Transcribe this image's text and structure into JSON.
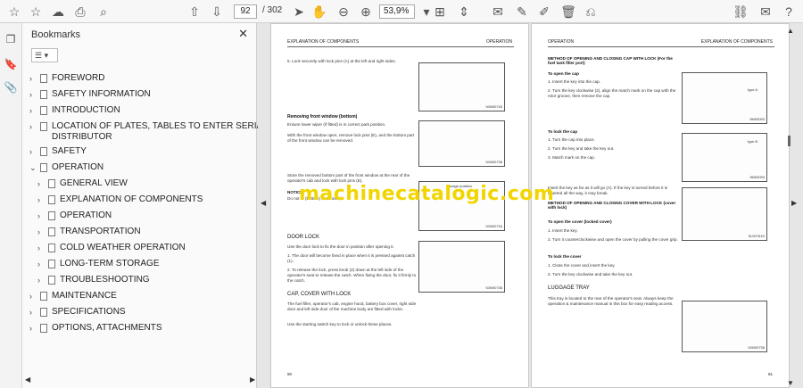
{
  "toolbar": {
    "page_current": "92",
    "page_total": "/ 302",
    "zoom": "53,9%"
  },
  "panel": {
    "title": "Bookmarks",
    "items": [
      {
        "label": "FOREWORD",
        "expanded": false
      },
      {
        "label": "SAFETY INFORMATION",
        "expanded": false
      },
      {
        "label": "INTRODUCTION",
        "expanded": false
      },
      {
        "label": "LOCATION OF PLATES, TABLES TO ENTER SERIAL NO. AND",
        "expanded": false
      },
      {
        "label": "DISTRIBUTOR"
      },
      {
        "label": "SAFETY",
        "expanded": false
      },
      {
        "label": "OPERATION",
        "expanded": true
      },
      {
        "label": "GENERAL VIEW",
        "expanded": false
      },
      {
        "label": "EXPLANATION OF COMPONENTS",
        "expanded": false
      },
      {
        "label": "OPERATION",
        "expanded": false
      },
      {
        "label": "TRANSPORTATION",
        "expanded": false
      },
      {
        "label": "COLD WEATHER OPERATION",
        "expanded": false
      },
      {
        "label": "LONG-TERM STORAGE",
        "expanded": false
      },
      {
        "label": "TROUBLESHOOTING",
        "expanded": false
      },
      {
        "label": "MAINTENANCE",
        "expanded": false
      },
      {
        "label": "SPECIFICATIONS",
        "expanded": false
      },
      {
        "label": "OPTIONS, ATTACHMENTS",
        "expanded": false
      }
    ]
  },
  "left_page": {
    "header_left": "EXPLANATION OF COMPONENTS",
    "header_right": "OPERATION",
    "step5": "5.   Lock securely with lock pins (A) at the left and right sides.",
    "fig1_id": "9JM00745",
    "removing_title": "Removing front window (bottom)",
    "removing_p1": "Ensure lower wiper (if fitted) is in correct park position.",
    "removing_p2": "With the front window open, remove lock pins (E), and the bottom part of the front window can be removed.",
    "fig2_id": "9JM00736",
    "store_p": "Store the removed bottom part of the front window at the rear of the operator's cab and lock with lock pins (E).",
    "notice_label": "NOTICE",
    "notice_text": "Do not ... (bottom) is removed.",
    "fig3_label": "Storage position",
    "fig3_id": "9JM00734",
    "door_title": "DOOR LOCK",
    "door_p1": "Use the door lock to fix the door in position after opening it.",
    "door_s1": "1.   The door will become fixed in place when it is pressed against catch (1).",
    "door_s2": "2.   To release the lock, press knob (2) down at the left side of the operator's seat to release the catch. When fixing the door, fix it firmly to the catch.",
    "fig4_id": "9JM00736",
    "cap_title": "CAP, COVER WITH LOCK",
    "cap_p1": "The fuel filler, operator's cab, engine hood, battery box cover, right side door and left side door of the machine body are fitted with locks.",
    "cap_p2": "Use the starting switch key to lock or unlock these places.",
    "page_no": "90"
  },
  "right_page": {
    "header_left": "OPERATION",
    "header_right": "EXPLANATION OF COMPONENTS",
    "method1_title": "METHOD OF OPENING AND CLOSING CAP WITH LOCK (For the fuel tank filler port)",
    "open_cap": "To open the cap",
    "oc1": "1.   Insert the key into the cap.",
    "oc2": "2.   Turn the key clockwise (2), align the match mark on the cap with the rotor groove, then remove the cap.",
    "typeA": "type A",
    "fig5_id": "9M00093",
    "lock_cap": "To lock the cap",
    "lc1": "1.   Turn the cap into place.",
    "lc2": "2.   Turn the key and take the key out.",
    "lc3": "3.   Match mark on the cap.",
    "typeB": "type B",
    "fig6_id": "9M00093",
    "insert_p": "Insert the key as far as it will go (A). If the key is turned before it is inserted all the way, it may break.",
    "method2_title": "METHOD OF OPENING AND CLOSING COVER WITH LOCK (cover with lock)",
    "open_cover": "To open the cover (locked cover)",
    "ov1": "1.   Insert the key.",
    "ov2": "2.   Turn it counterclockwise and open the cover by pulling the cover grip.",
    "fig7_id": "9L00761S",
    "lock_cover": "To lock the cover",
    "lv1": "1.   Close the cover and insert the key.",
    "lv2": "2.   Turn the key clockwise and take the key out.",
    "luggage_title": "LUGGAGE TRAY",
    "luggage_p": "This tray is located to the rear of the operator's seat. Always keep the operation & maintenance manual in this box for easy reading access.",
    "fig8_id": "9JM00736",
    "page_no": "91"
  },
  "watermark": "machinecatalogic.com"
}
